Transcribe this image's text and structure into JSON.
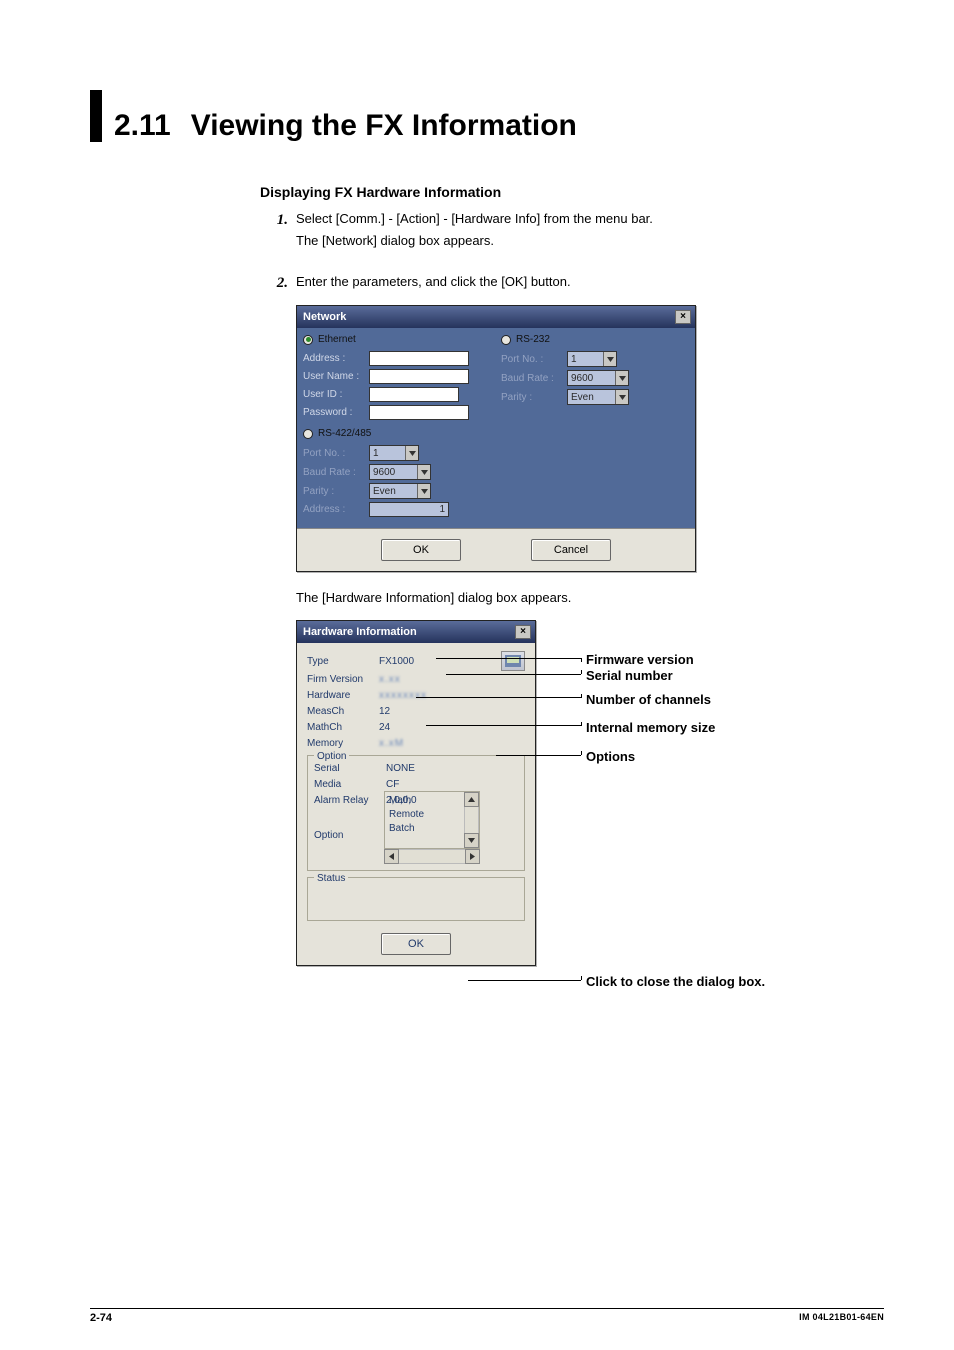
{
  "heading": {
    "number": "2.11",
    "title": "Viewing the FX Information"
  },
  "sub_heading": "Displaying FX Hardware Information",
  "steps": [
    {
      "num": "1.",
      "lines": [
        "Select [Comm.] - [Action] - [Hardware Info] from the menu bar.",
        "The [Network] dialog box appears."
      ]
    },
    {
      "num": "2.",
      "lines": [
        "Enter the parameters, and click the [OK] button."
      ]
    }
  ],
  "network_dialog": {
    "title": "Network",
    "ethernet": {
      "radio_label": "Ethernet",
      "selected": true,
      "fields": {
        "address": "Address :",
        "username": "User Name :",
        "userid": "User ID :",
        "password": "Password :"
      }
    },
    "rs232": {
      "radio_label": "RS-232",
      "selected": false,
      "fields": {
        "portno": "Port No. :",
        "baud": "Baud Rate :",
        "parity": "Parity :"
      },
      "values": {
        "portno": "1",
        "baud": "9600",
        "parity": "Even"
      }
    },
    "rs422": {
      "radio_label": "RS-422/485",
      "selected": false,
      "fields": {
        "portno": "Port No. :",
        "baud": "Baud Rate :",
        "parity": "Parity :",
        "address": "Address :"
      },
      "values": {
        "portno": "1",
        "baud": "9600",
        "parity": "Even",
        "address": "1"
      }
    },
    "buttons": {
      "ok": "OK",
      "cancel": "Cancel"
    }
  },
  "after_network": "The [Hardware Information] dialog box appears.",
  "hwi_dialog": {
    "title": "Hardware Information",
    "rows": {
      "type_l": "Type",
      "type_v": "FX1000",
      "firm_l": "Firm Version",
      "firm_v": "x.xx",
      "hw_l": "Hardware",
      "hw_v": "xxxxxxxx",
      "meas_l": "MeasCh",
      "meas_v": "12",
      "math_l": "MathCh",
      "math_v": "24",
      "mem_l": "Memory",
      "mem_v": "x.xM"
    },
    "option_legend": "Option",
    "serial_l": "Serial",
    "serial_v": "NONE",
    "media_l": "Media",
    "media_v": "CF",
    "alarm_l": "Alarm Relay",
    "alarm_v": "2,0,0,0",
    "option_l": "Option",
    "option_items": [
      "Math",
      "Remote",
      "Batch"
    ],
    "status_legend": "Status",
    "ok": "OK"
  },
  "callouts": {
    "firmware": "Firmware version",
    "serial": "Serial number",
    "channels": "Number of channels",
    "memory": "Internal memory size",
    "options": "Options",
    "close": "Click to close the dialog box."
  },
  "footer": {
    "left": "2-74",
    "right": "IM 04L21B01-64EN"
  }
}
